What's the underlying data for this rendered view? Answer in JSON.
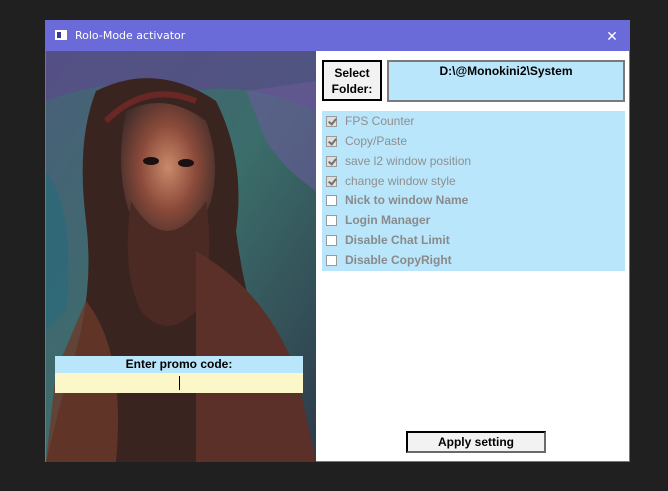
{
  "window": {
    "title": "Rolo-Mode activator",
    "close_glyph": "✕"
  },
  "folder": {
    "button_label_line1": "Select",
    "button_label_line2": "Folder:",
    "path": "D:\\@Monokini2\\System"
  },
  "options": [
    {
      "label": "FPS Counter",
      "checked": true,
      "struck": true
    },
    {
      "label": "Copy/Paste",
      "checked": true,
      "struck": true
    },
    {
      "label": "save l2 window position",
      "checked": true,
      "struck": true
    },
    {
      "label": "change window style",
      "checked": true,
      "struck": true
    },
    {
      "label": "Nick to window Name",
      "checked": false,
      "struck": false
    },
    {
      "label": "Login Manager",
      "checked": false,
      "struck": false
    },
    {
      "label": "Disable Chat Limit",
      "checked": false,
      "struck": false
    },
    {
      "label": "Disable CopyRight",
      "checked": false,
      "struck": false
    }
  ],
  "promo": {
    "label": "Enter promo code:",
    "value": ""
  },
  "apply": {
    "label": "Apply setting"
  },
  "colors": {
    "titlebar": "#6a6ad8",
    "panel_blue": "#b9e6fb",
    "input_yellow": "#fbf7c9"
  },
  "icons": {
    "window_icon": "app-window-icon",
    "close": "close-icon"
  }
}
